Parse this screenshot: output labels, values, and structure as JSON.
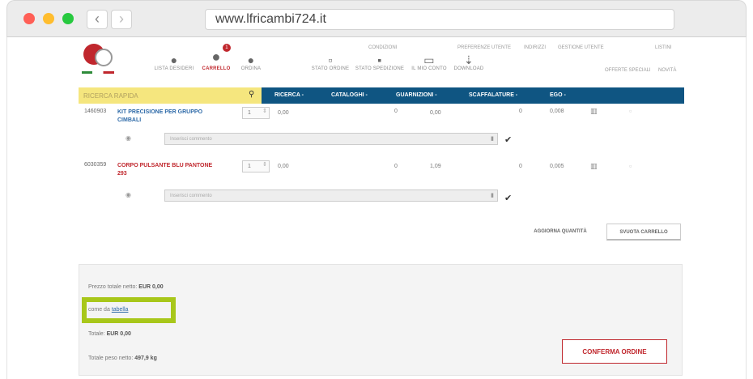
{
  "browser": {
    "url": "www.lfricambi724.it",
    "back_glyph": "‹",
    "forward_glyph": "›"
  },
  "header": {
    "icons": [
      {
        "label": "LISTA DESIDERI",
        "icon": "heart-icon",
        "glyph": "●"
      },
      {
        "label": "CARRELLO",
        "icon": "cart-icon",
        "glyph": "●",
        "badge": "1"
      },
      {
        "label": "ORDINA",
        "icon": "order-icon",
        "glyph": "●"
      },
      {
        "label": "STATO ORDINE",
        "icon": "document-icon",
        "glyph": "▫"
      },
      {
        "label": "STATO SPEDIZIONE",
        "icon": "truck-icon",
        "glyph": "▪"
      },
      {
        "label": "IL MIO CONTO",
        "icon": "calendar-icon",
        "glyph": "▭"
      },
      {
        "label": "DOWNLOAD",
        "icon": "download-icon",
        "glyph": "⇣"
      }
    ],
    "top_links": [
      "CONDIZIONI",
      "PREFERENZE UTENTE",
      "INDIRIZZI",
      "GESTIONE UTENTE",
      "LISTINI"
    ],
    "second_links": [
      "OFFERTE SPECIALI",
      "NOVITÀ"
    ]
  },
  "nav": {
    "search_placeholder": "RICERCA RAPIDA",
    "items": [
      "RICERCA -",
      "CATALOGHI -",
      "GUARNIZIONI -",
      "SCAFFALATURE -",
      "EGO -"
    ]
  },
  "products": [
    {
      "code": "1460903",
      "name": "KIT PRECISIONE PER GRUPPO CIMBALI",
      "qty": "1",
      "price": "0,00",
      "col_a": "0",
      "col_b": "0,00",
      "col_c": "0",
      "weight": "0,008",
      "comment_placeholder": "Inserisci commento"
    },
    {
      "code": "6030359",
      "name": "CORPO PULSANTE BLU PANTONE 293",
      "qty": "1",
      "price": "0,00",
      "col_a": "0",
      "col_b": "1,09",
      "col_c": "0",
      "weight": "0,005",
      "comment_placeholder": "Inserisci commento"
    }
  ],
  "actions": {
    "update_qty": "AGGIORNA QUANTITÀ",
    "empty_cart": "SVUOTA CARRELLO"
  },
  "summary": {
    "net_total_label": "Prezzo totale netto:",
    "net_total_value": "EUR 0,00",
    "as_per_label": "come da",
    "as_per_link": "tabella",
    "total_label": "Totale:",
    "total_value": "EUR 0,00",
    "weight_label": "Totale peso netto:",
    "weight_value": "497,9 kg",
    "confirm": "CONFERMA ORDINE"
  }
}
